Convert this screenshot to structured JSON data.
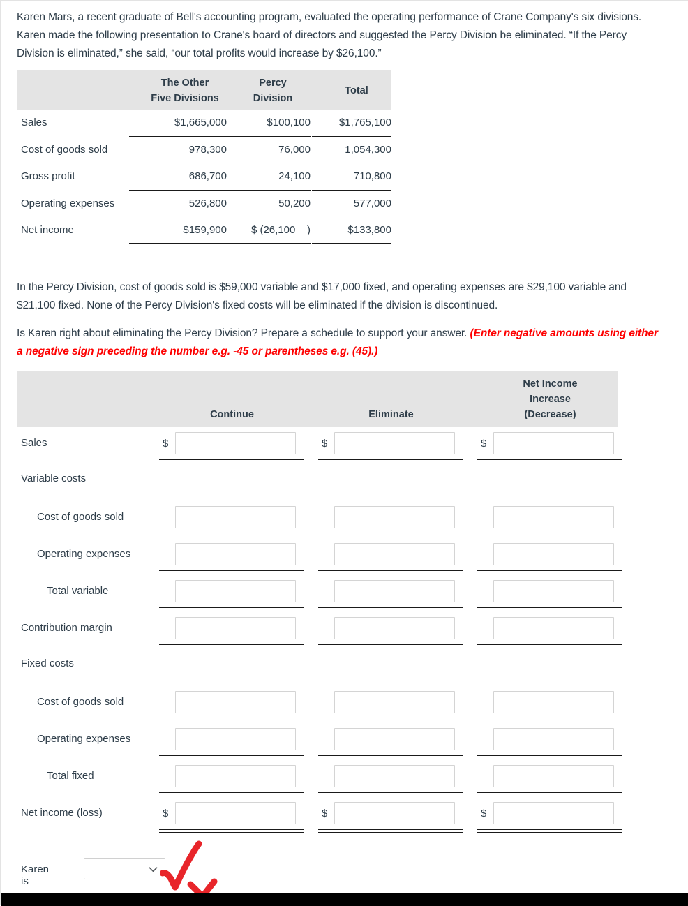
{
  "intro": {
    "paragraph": "Karen Mars, a recent graduate of Bell's accounting program, evaluated the operating performance of Crane Company's six divisions. Karen made the following presentation to Crane's board of directors and suggested the Percy Division be eliminated. “If the Percy Division is eliminated,” she said, “our total profits would increase by $26,100.”"
  },
  "table1": {
    "headers": {
      "col1": "The Other\nFive Divisions",
      "col1_line1": "The Other",
      "col1_line2": "Five Divisions",
      "col2_line1": "Percy",
      "col2_line2": "Division",
      "col3": "Total"
    },
    "rows": [
      {
        "label": "Sales",
        "other": "$1,665,000",
        "percy": "$100,100",
        "total": "$1,765,100",
        "rule": "none"
      },
      {
        "label": "Cost of goods sold",
        "other": "978,300",
        "percy": "76,000",
        "total": "1,054,300",
        "rule": "single"
      },
      {
        "label": "Gross profit",
        "other": "686,700",
        "percy": "24,100",
        "total": "710,800",
        "rule": "none"
      },
      {
        "label": "Operating expenses",
        "other": "526,800",
        "percy": "50,200",
        "total": "577,000",
        "rule": "single"
      },
      {
        "label": "Net income",
        "other": "$159,900",
        "percy": "$ (26,100    )",
        "total": "$133,800",
        "rule": "double"
      }
    ]
  },
  "middle": {
    "paragraph2": "In the Percy Division, cost of goods sold is $59,000 variable and $17,000 fixed, and operating expenses are $29,100 variable and $21,100 fixed. None of the Percy Division's fixed costs will be eliminated if the division is discontinued.",
    "paragraph3_black": "Is Karen right about eliminating the Percy Division? Prepare a schedule to support your answer. ",
    "paragraph3_red": "(Enter negative amounts using either a negative sign preceding the number e.g. -45 or parentheses e.g. (45).)"
  },
  "table2": {
    "headers": {
      "continue": "Continue",
      "eliminate": "Eliminate",
      "netincome_line1": "Net Income",
      "netincome_line2": "Increase",
      "netincome_line3": "(Decrease)"
    },
    "dollar_sign": "$",
    "rows": [
      {
        "label": "Sales",
        "indent": 0,
        "inputs": true,
        "dollar": true,
        "rule": "single",
        "value_continue": "",
        "value_eliminate": "",
        "value_net": ""
      },
      {
        "label": "Variable costs",
        "indent": 0,
        "inputs": false,
        "dollar": false,
        "rule": "none"
      },
      {
        "label": "Cost of goods sold",
        "indent": 1,
        "inputs": true,
        "dollar": false,
        "rule": "none",
        "value_continue": "",
        "value_eliminate": "",
        "value_net": ""
      },
      {
        "label": "Operating expenses",
        "indent": 1,
        "inputs": true,
        "dollar": false,
        "rule": "single",
        "value_continue": "",
        "value_eliminate": "",
        "value_net": ""
      },
      {
        "label": "Total variable",
        "indent": 2,
        "inputs": true,
        "dollar": false,
        "rule": "single",
        "value_continue": "",
        "value_eliminate": "",
        "value_net": ""
      },
      {
        "label": "Contribution margin",
        "indent": 0,
        "inputs": true,
        "dollar": false,
        "rule": "single",
        "value_continue": "",
        "value_eliminate": "",
        "value_net": ""
      },
      {
        "label": "Fixed costs",
        "indent": 0,
        "inputs": false,
        "dollar": false,
        "rule": "none"
      },
      {
        "label": "Cost of goods sold",
        "indent": 1,
        "inputs": true,
        "dollar": false,
        "rule": "none",
        "value_continue": "",
        "value_eliminate": "",
        "value_net": ""
      },
      {
        "label": "Operating expenses",
        "indent": 1,
        "inputs": true,
        "dollar": false,
        "rule": "single",
        "value_continue": "",
        "value_eliminate": "",
        "value_net": ""
      },
      {
        "label": "Total fixed",
        "indent": 2,
        "inputs": true,
        "dollar": false,
        "rule": "single",
        "value_continue": "",
        "value_eliminate": "",
        "value_net": ""
      },
      {
        "label": "Net income (loss)",
        "indent": 0,
        "inputs": true,
        "dollar": true,
        "rule": "double",
        "value_continue": "",
        "value_eliminate": "",
        "value_net": ""
      }
    ]
  },
  "footer": {
    "karen_label": "Karen is",
    "select_value": "",
    "select_icon": "chevron-down-icon"
  },
  "annotation": {
    "marks": [
      "check-mark",
      "x-mark"
    ],
    "color": "#e8252a"
  },
  "colors": {
    "header_bg": "#e4e4e4",
    "text": "#2e3d49",
    "red_instruction": "#fe0000",
    "annotation_red": "#e8252a",
    "rule": "#1a1a1a",
    "input_border": "#d4d4d4"
  }
}
